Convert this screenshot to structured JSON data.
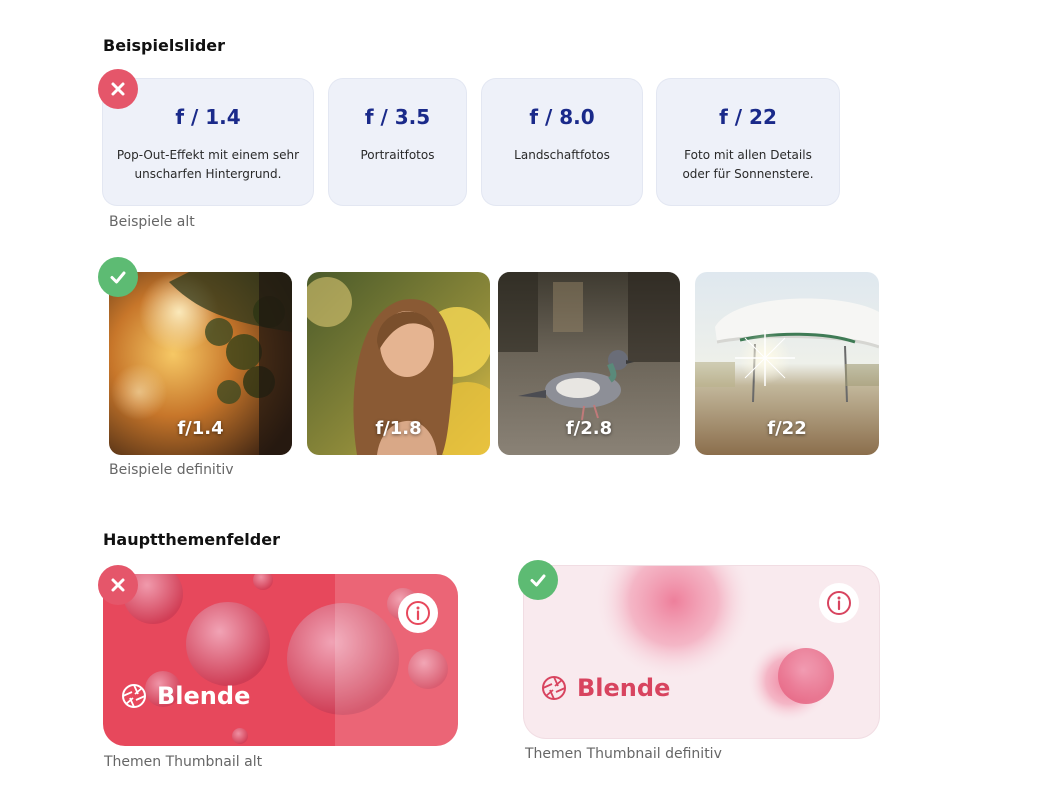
{
  "sections": {
    "slider_heading": "Beispielslider",
    "themes_heading": "Hauptthemenfelder"
  },
  "old_examples": {
    "caption": "Beispiele alt",
    "cards": [
      {
        "title": "f / 1.4",
        "desc": "Pop-Out-Effekt mit einem sehr unscharfen Hintergrund."
      },
      {
        "title": "f / 3.5",
        "desc": "Portraitfotos"
      },
      {
        "title": "f / 8.0",
        "desc": "Landschaftfotos"
      },
      {
        "title": "f / 22",
        "desc": "Foto mit allen Details oder für Sonnenstere."
      }
    ]
  },
  "new_examples": {
    "caption": "Beispiele definitiv",
    "photos": [
      {
        "label": "f/1.4",
        "subject": "bokeh foliage"
      },
      {
        "label": "f/1.8",
        "subject": "portrait woman"
      },
      {
        "label": "f/2.8",
        "subject": "pigeon street"
      },
      {
        "label": "f/22",
        "subject": "pavilion sunstar"
      }
    ]
  },
  "themes": {
    "old": {
      "title": "Blende",
      "caption": "Themen Thumbnail alt"
    },
    "new": {
      "title": "Blende",
      "caption": "Themen Thumbnail definitiv"
    }
  },
  "icons": {
    "reject": "close-icon",
    "approve": "check-icon",
    "info": "info-icon",
    "aperture": "aperture-icon"
  },
  "colors": {
    "reject": "#e5566a",
    "approve": "#5dbb73",
    "card_title": "#1a2a8a",
    "thumb_old_bg": "#e7485c",
    "thumb_new_bg": "#f9eaee",
    "thumb_new_title": "#d8445f"
  }
}
